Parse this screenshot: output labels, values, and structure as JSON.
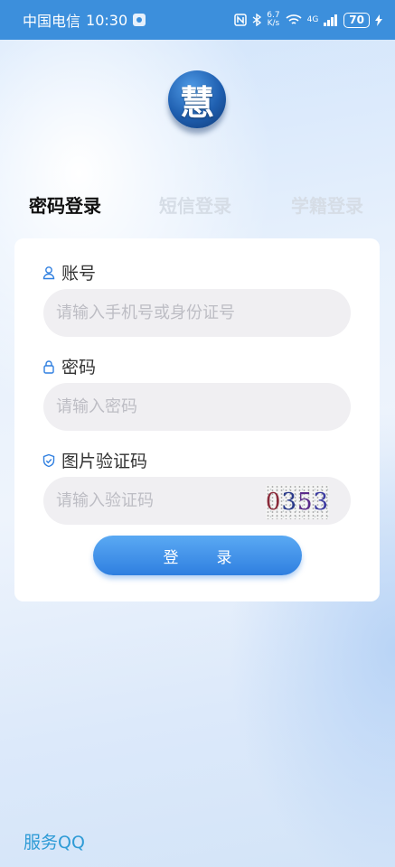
{
  "status_bar": {
    "carrier": "中国电信",
    "time": "10:30",
    "net_speed_value": "6.7",
    "net_speed_unit": "K/s",
    "signal_label": "4G",
    "battery": "70"
  },
  "logo": {
    "char": "慧"
  },
  "tabs": [
    {
      "label": "密码登录",
      "active": true
    },
    {
      "label": "短信登录",
      "active": false
    },
    {
      "label": "学籍登录",
      "active": false
    }
  ],
  "form": {
    "account": {
      "label": "账号",
      "placeholder": "请输入手机号或身份证号",
      "icon": "user-icon"
    },
    "password": {
      "label": "密码",
      "placeholder": "请输入密码",
      "icon": "lock-icon"
    },
    "captcha": {
      "label": "图片验证码",
      "placeholder": "请输入验证码",
      "icon": "shield-check-icon",
      "image_chars": [
        "0",
        "3",
        "5",
        "3"
      ],
      "image_colors": [
        "#8a2a3a",
        "#2a3a8a",
        "#5a2a8a",
        "#3a3aa0"
      ]
    },
    "submit_chars": [
      "登",
      "录"
    ]
  },
  "footer": {
    "service_link": "服务QQ"
  },
  "colors": {
    "status_bar": "#3c8fdc",
    "accent": "#2f7fe0",
    "link": "#2f9bd6"
  }
}
